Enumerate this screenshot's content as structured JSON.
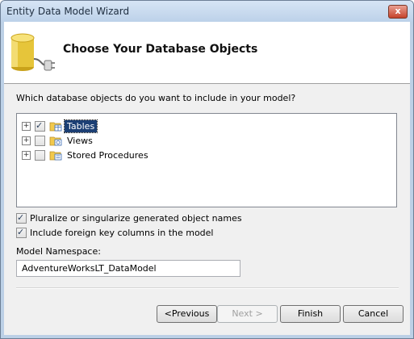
{
  "window": {
    "title": "Entity Data Model Wizard",
    "close_glyph": "x"
  },
  "header": {
    "title": "Choose Your Database Objects",
    "icon": "database-plug-icon"
  },
  "main": {
    "question": "Which database objects do you want to include in your model?",
    "tree": [
      {
        "label": "Tables",
        "checked": true,
        "selected": true,
        "expander": "+"
      },
      {
        "label": "Views",
        "checked": false,
        "selected": false,
        "expander": "+"
      },
      {
        "label": "Stored Procedures",
        "checked": false,
        "selected": false,
        "expander": "+"
      }
    ],
    "options": {
      "pluralize_label": "Pluralize or singularize generated object names",
      "pluralize_checked": true,
      "fk_label": "Include foreign key columns in the model",
      "fk_checked": true
    },
    "namespace_label": "Model Namespace:",
    "namespace_value": "AdventureWorksLT_DataModel"
  },
  "buttons": {
    "previous": "<Previous",
    "next": "Next >",
    "finish": "Finish",
    "cancel": "Cancel"
  },
  "colors": {
    "selection": "#1c3f74",
    "title_bar": "#bcd1e9",
    "close_button": "#c5422b"
  }
}
